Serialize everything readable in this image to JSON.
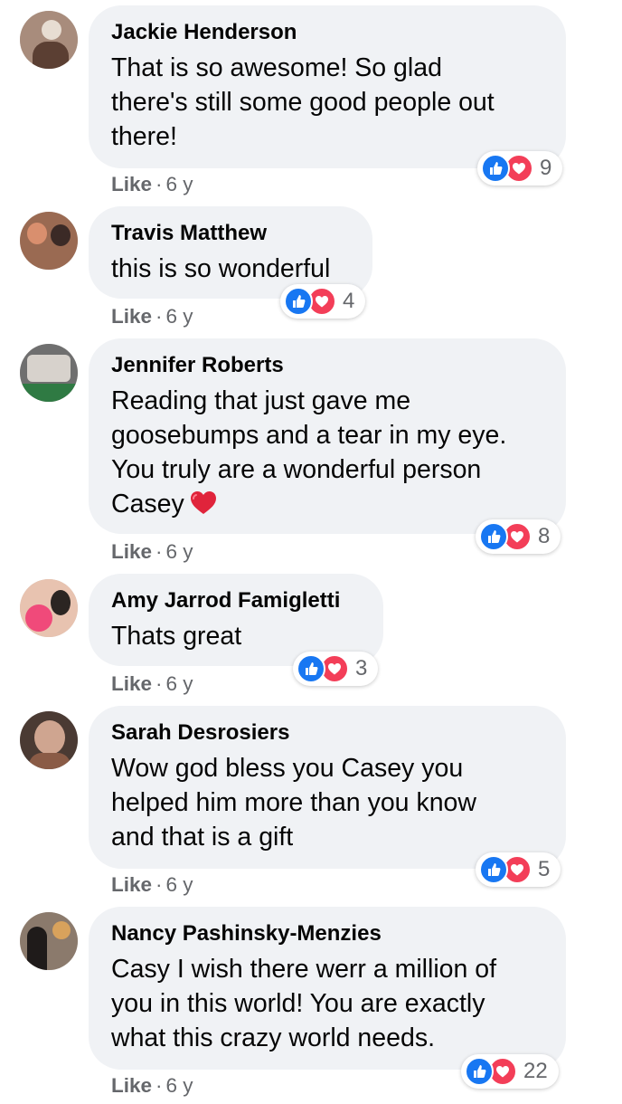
{
  "comments": [
    {
      "author": "Jackie Henderson",
      "text": "That is so awesome! So glad\nthere's still some good people out\nthere!",
      "action": "Like",
      "separator": "·",
      "time": "6 y",
      "reaction_count": "9",
      "avatar_colors": [
        "#a88c7c",
        "#e7ddd2",
        "#5b3f33"
      ]
    },
    {
      "author": "Travis Matthew",
      "text": "this is so wonderful",
      "action": "Like",
      "separator": "·",
      "time": "6 y",
      "reaction_count": "4",
      "avatar_colors": [
        "#9a6a52",
        "#d98f6e",
        "#3b2a26"
      ]
    },
    {
      "author": "Jennifer Roberts",
      "text": "Reading that just gave me\ngoosebumps and a tear in my eye.\nYou truly are a wonderful person\nCasey",
      "action": "Like",
      "separator": "·",
      "time": "6 y",
      "reaction_count": "8",
      "avatar_colors": [
        "#6f6f6f",
        "#d7d2cc",
        "#2f7a43"
      ]
    },
    {
      "author": "Amy Jarrod Famigletti",
      "text": "Thats great",
      "action": "Like",
      "separator": "·",
      "time": "6 y",
      "reaction_count": "3",
      "avatar_colors": [
        "#e8c3b0",
        "#f04a7a",
        "#2b2522"
      ]
    },
    {
      "author": "Sarah Desrosiers",
      "text": "Wow god bless you Casey you\nhelped him more than you know\nand that is a gift",
      "action": "Like",
      "separator": "·",
      "time": "6 y",
      "reaction_count": "5",
      "avatar_colors": [
        "#4a3a33",
        "#cfa590",
        "#8a5b46"
      ]
    },
    {
      "author": "Nancy Pashinsky-Menzies",
      "text": "Casy I wish there werr a million of\nyou in this world! You are exactly\nwhat this crazy world needs.",
      "action": "Like",
      "separator": "·",
      "time": "6 y",
      "reaction_count": "22",
      "avatar_colors": [
        "#8b7a6c",
        "#1f1b1a",
        "#d8a25c"
      ]
    }
  ],
  "colors": {
    "bubble_bg": "#f0f2f5",
    "like_blue": "#1877f2",
    "love_red": "#f33e58",
    "meta_gray": "#65676b"
  },
  "icons": {
    "like": "thumbs-up-icon",
    "love": "heart-icon",
    "inline_emoji": "red-heart-emoji-icon"
  }
}
